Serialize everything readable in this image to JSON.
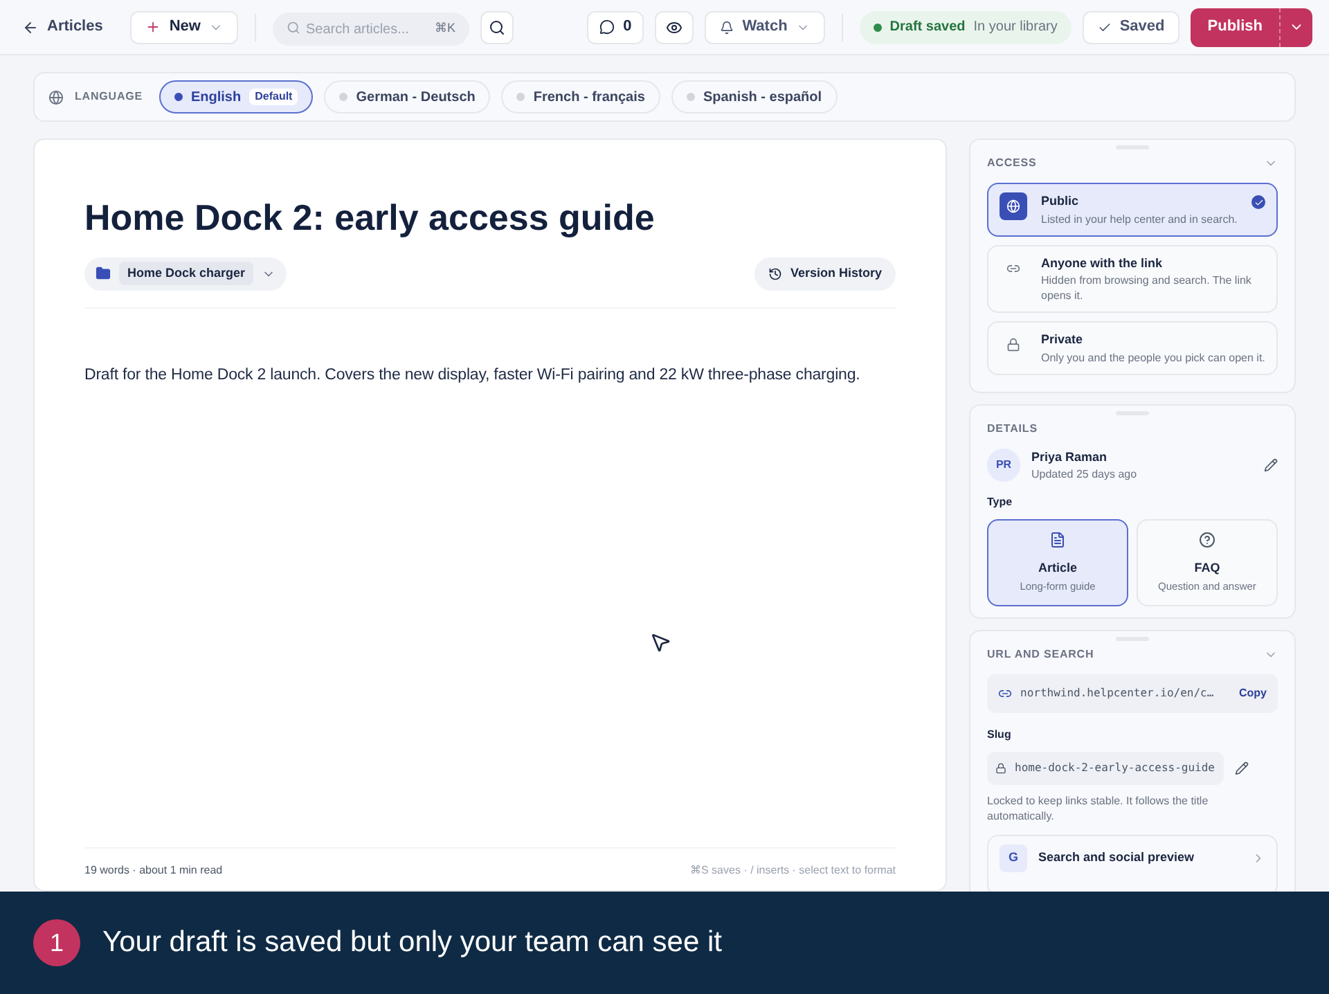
{
  "topbar": {
    "back": "Articles",
    "new": "New",
    "search": {
      "placeholder": "Search articles...",
      "shortcut": "⌘K"
    },
    "comments": "0",
    "watch": "Watch",
    "status": {
      "label": "Draft saved",
      "detail": "In your library"
    },
    "saved": "Saved",
    "publish": "Publish"
  },
  "language": {
    "label": "LANGUAGE",
    "items": [
      {
        "name": "English",
        "badge": "Default",
        "selected": true
      },
      {
        "name": "German - Deutsch",
        "selected": false
      },
      {
        "name": "French - français",
        "selected": false
      },
      {
        "name": "Spanish - español",
        "selected": false
      }
    ]
  },
  "editor": {
    "title": "Home Dock 2: early access guide",
    "collection": "Home Dock charger",
    "version_history": "Version History",
    "body": "Draft for the Home Dock 2 launch. Covers the new display, faster Wi-Fi pairing and 22 kW three-phase charging.",
    "footer_left": "19 words · about 1 min read",
    "footer_right": "⌘S saves · / inserts · select text to format"
  },
  "access": {
    "title": "ACCESS",
    "options": [
      {
        "kind": "globe",
        "title": "Public",
        "description": "Listed in your help center and in search.",
        "selected": true
      },
      {
        "kind": "link",
        "title": "Anyone with the link",
        "description": "Hidden from browsing and search. The link opens it.",
        "selected": false
      },
      {
        "kind": "lock",
        "title": "Private",
        "description": "Only you and the people you pick can open it.",
        "selected": false
      }
    ]
  },
  "details": {
    "title": "DETAILS",
    "author": {
      "initials": "PR",
      "name": "Priya Raman",
      "updated": "Updated 25 days ago"
    },
    "type_label": "Type",
    "types": [
      {
        "kind": "article",
        "title": "Article",
        "description": "Long-form guide",
        "selected": true
      },
      {
        "kind": "faq",
        "title": "FAQ",
        "description": "Question and answer",
        "selected": false
      }
    ]
  },
  "url": {
    "title": "URL AND SEARCH",
    "url": "northwind.helpcenter.io/en/c…",
    "copy": "Copy",
    "slug_label": "Slug",
    "slug": "home-dock-2-early-access-guide",
    "slug_note": "Locked to keep links stable. It follows the title automatically.",
    "preview": {
      "letter": "G",
      "title": "Search and social preview"
    }
  },
  "banner": {
    "step": "1",
    "text": "Your draft is saved but only your team can see it"
  }
}
